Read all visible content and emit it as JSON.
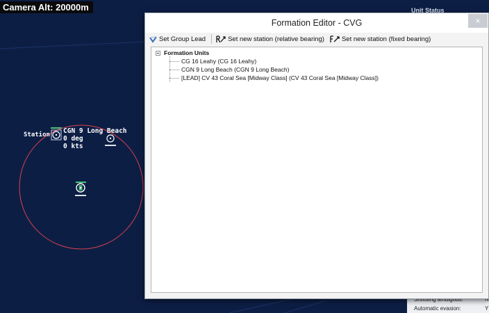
{
  "map": {
    "camera_alt": "Camera Alt: 20000m",
    "station_label": "Station",
    "unit_name": "CGN 9 Long Beach",
    "unit_heading": "0 deg",
    "unit_speed": "0 kts"
  },
  "side_panel": {
    "header": "Unit Status",
    "rows": [
      {
        "label": "Shooting ambigous:",
        "value": "N"
      },
      {
        "label": "Automatic evasion:",
        "value": "Y"
      }
    ]
  },
  "dialog": {
    "title": "Formation Editor - CVG",
    "close_glyph": "×",
    "toolbar": {
      "set_group_lead": "Set Group Lead",
      "set_relative": "Set new station (relative bearing)",
      "set_fixed": "Set new station (fixed bearing)"
    },
    "tree": {
      "root": "Formation Units",
      "items": [
        "CG 16 Leahy (CG 16 Leahy)",
        "CGN 9 Long Beach (CGN 9 Long Beach)",
        "[LEAD] CV 43 Coral Sea [Midway Class] (CV 43 Coral Sea [Midway Class])"
      ]
    }
  },
  "colors": {
    "map_background": "#0d1e45",
    "range_ring": "#d9424a",
    "unit_marker": "#4cc37a"
  }
}
